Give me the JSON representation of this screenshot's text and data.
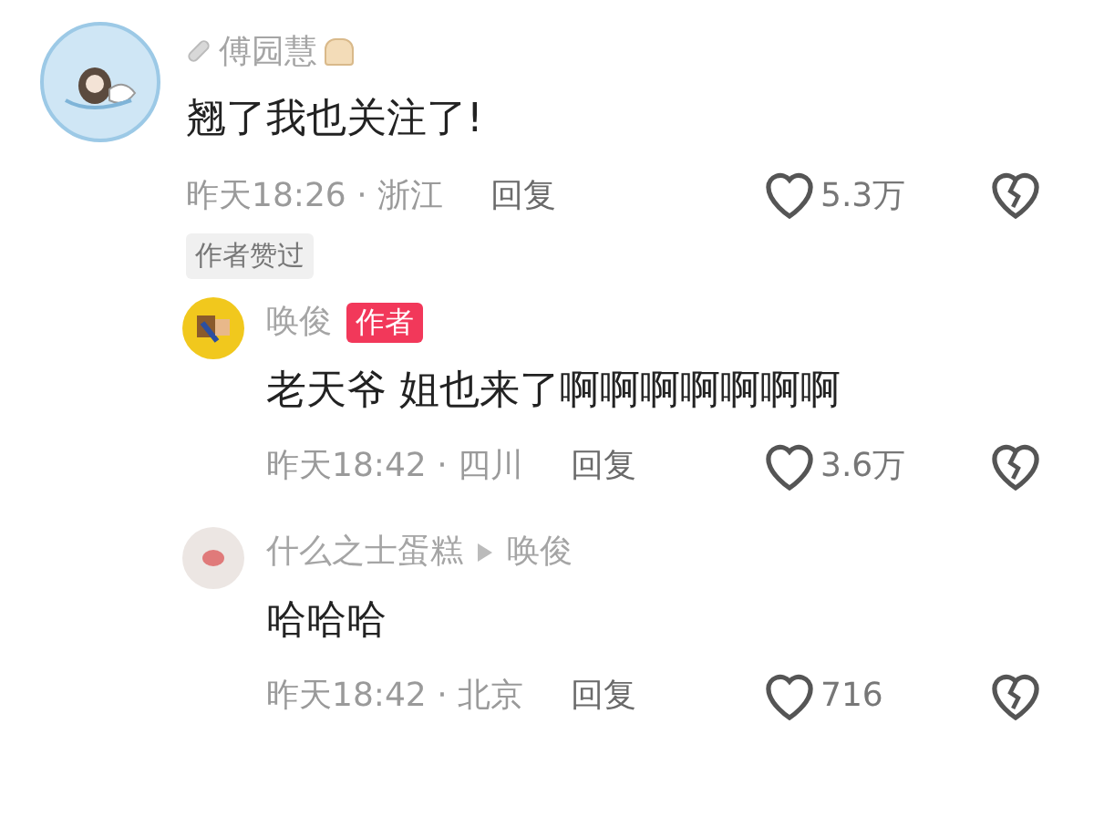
{
  "comments": [
    {
      "name": "傅园慧",
      "text": "翘了我也关注了!",
      "time_place": "昨天18:26 · 浙江",
      "reply": "回复",
      "likes": "5.3万",
      "tag": "作者赞过",
      "children": [
        {
          "name": "唤俊",
          "author_badge": "作者",
          "text": "老天爷 姐也来了啊啊啊啊啊啊啊",
          "time_place": "昨天18:42 · 四川",
          "reply": "回复",
          "likes": "3.6万"
        },
        {
          "name": "什么之士蛋糕",
          "reply_to": "唤俊",
          "text": "哈哈哈",
          "time_place": "昨天18:42 · 北京",
          "reply": "回复",
          "likes": "716"
        }
      ]
    }
  ]
}
